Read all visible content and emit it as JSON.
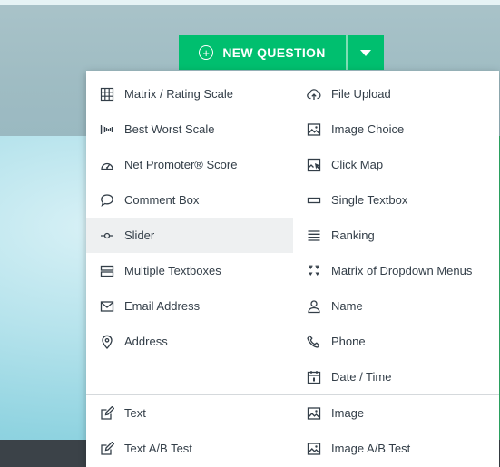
{
  "new_question": {
    "label": "NEW QUESTION",
    "plus_icon": "plus-circle-icon",
    "caret_icon": "caret-down-icon",
    "color": "#00bf6f"
  },
  "menu": {
    "hovered": "Slider",
    "left": [
      {
        "label": "Matrix / Rating Scale",
        "icon": "grid-icon"
      },
      {
        "label": "Best Worst Scale",
        "icon": "best-worst-icon"
      },
      {
        "label": "Net Promoter® Score",
        "icon": "gauge-icon"
      },
      {
        "label": "Comment Box",
        "icon": "comment-icon"
      },
      {
        "label": "Slider",
        "icon": "slider-icon"
      },
      {
        "label": "Multiple Textboxes",
        "icon": "multiple-textboxes-icon"
      },
      {
        "label": "Email Address",
        "icon": "envelope-icon"
      },
      {
        "label": "Address",
        "icon": "map-pin-icon"
      }
    ],
    "right": [
      {
        "label": "File Upload",
        "icon": "cloud-upload-icon"
      },
      {
        "label": "Image Choice",
        "icon": "image-icon"
      },
      {
        "label": "Click Map",
        "icon": "click-map-icon"
      },
      {
        "label": "Single Textbox",
        "icon": "textbox-icon"
      },
      {
        "label": "Ranking",
        "icon": "ranking-icon"
      },
      {
        "label": "Matrix of Dropdown Menus",
        "icon": "dropdown-matrix-icon"
      },
      {
        "label": "Name",
        "icon": "person-icon"
      },
      {
        "label": "Phone",
        "icon": "phone-icon"
      },
      {
        "label": "Date / Time",
        "icon": "calendar-icon"
      }
    ],
    "bottom_left": [
      {
        "label": "Text",
        "icon": "edit-icon"
      },
      {
        "label": "Text A/B Test",
        "icon": "edit-icon"
      }
    ],
    "bottom_right": [
      {
        "label": "Image",
        "icon": "image-icon"
      },
      {
        "label": "Image A/B Test",
        "icon": "image-icon"
      }
    ]
  }
}
